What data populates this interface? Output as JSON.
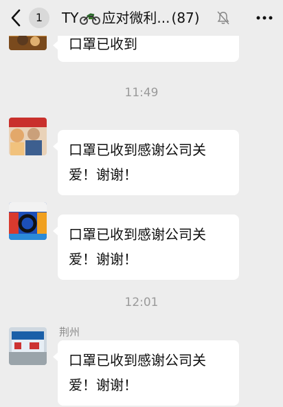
{
  "header": {
    "unread_count": "1",
    "title_prefix": "TY",
    "title_suffix": "应对微利...",
    "member_count": "(87)"
  },
  "messages": [
    {
      "text": "口罩已收到"
    },
    {
      "time": "11:49"
    },
    {
      "text": "口罩已收到感谢公司关爱！谢谢！"
    },
    {
      "text": "口罩已收到感谢公司关爱！谢谢！"
    },
    {
      "time": "12:01"
    },
    {
      "sender": "荆州",
      "text": "口罩已收到感谢公司关爱！谢谢！"
    }
  ],
  "icons": {
    "back": "chevron-left-icon",
    "mute": "bell-slash-icon",
    "more": "more-horizontal-icon",
    "emoji": "motorcycle-icon"
  },
  "colors": {
    "background": "#ededed",
    "bubble": "#ffffff",
    "badge": "#d9d9d9",
    "timestamp": "#9a9a9a"
  }
}
